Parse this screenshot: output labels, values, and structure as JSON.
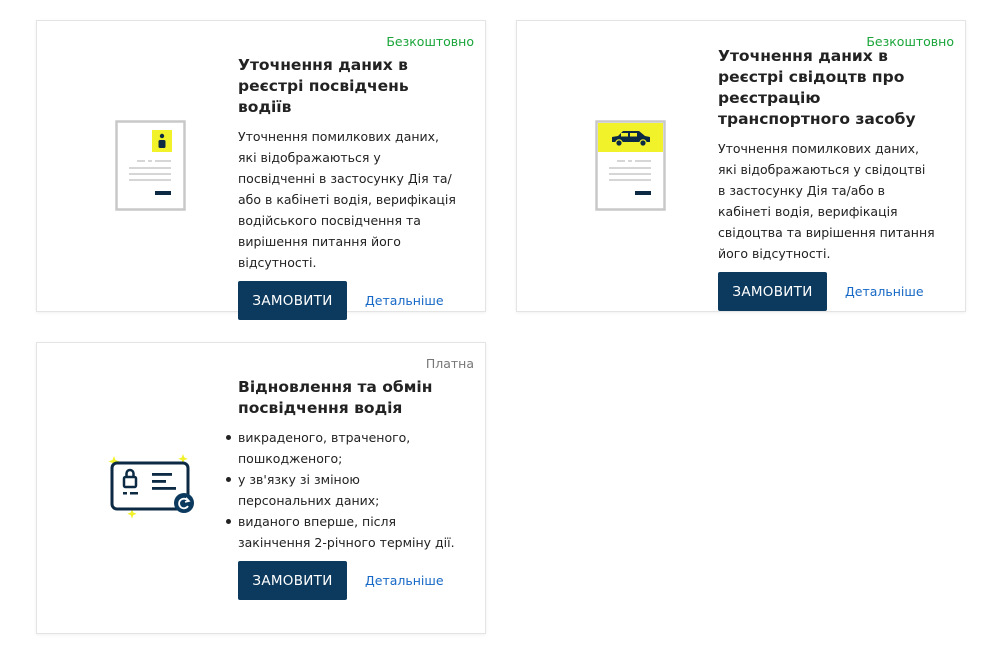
{
  "cards": [
    {
      "badge": "Безкоштовно",
      "title": "Уточнення даних в реєстрі посвідчень водіїв",
      "description": "Уточнення помилкових даних, які відображаються у посвідченні в застосунку Дія та/або в кабінеті водія, верифікація водійського посвідчення та вирішення питання його відсутності.",
      "button": "ЗАМОВИТИ",
      "link": "Детальніше",
      "icon": "license-document-icon"
    },
    {
      "badge": "Безкоштовно",
      "title": "Уточнення даних в реєстрі свідоцтв про реєстрацію транспортного засобу",
      "description": "Уточнення помилкових даних, які відображаються у свідоцтві в застосунку Дія та/або в кабінеті водія, верифікація свідоцтва та вирішення питання його відсутності.",
      "button": "ЗАМОВИТИ",
      "link": "Детальніше",
      "icon": "vehicle-certificate-icon"
    },
    {
      "badge": "Платна",
      "title": "Відновлення та обмін посвідчення водія",
      "bullets": [
        "викраденого, втраченого, пошкодженого;",
        "у зв'язку зі зміною персональних даних;",
        "виданого вперше, після закінчення 2-річного терміну дії."
      ],
      "button": "ЗАМОВИТИ",
      "link": "Детальніше",
      "icon": "id-card-renew-icon"
    }
  ],
  "colors": {
    "primary_button": "#0c3a5e",
    "free_badge": "#1aa53a",
    "paid_badge": "#777777",
    "link": "#1668c6",
    "accent_yellow": "#f2f22a"
  }
}
